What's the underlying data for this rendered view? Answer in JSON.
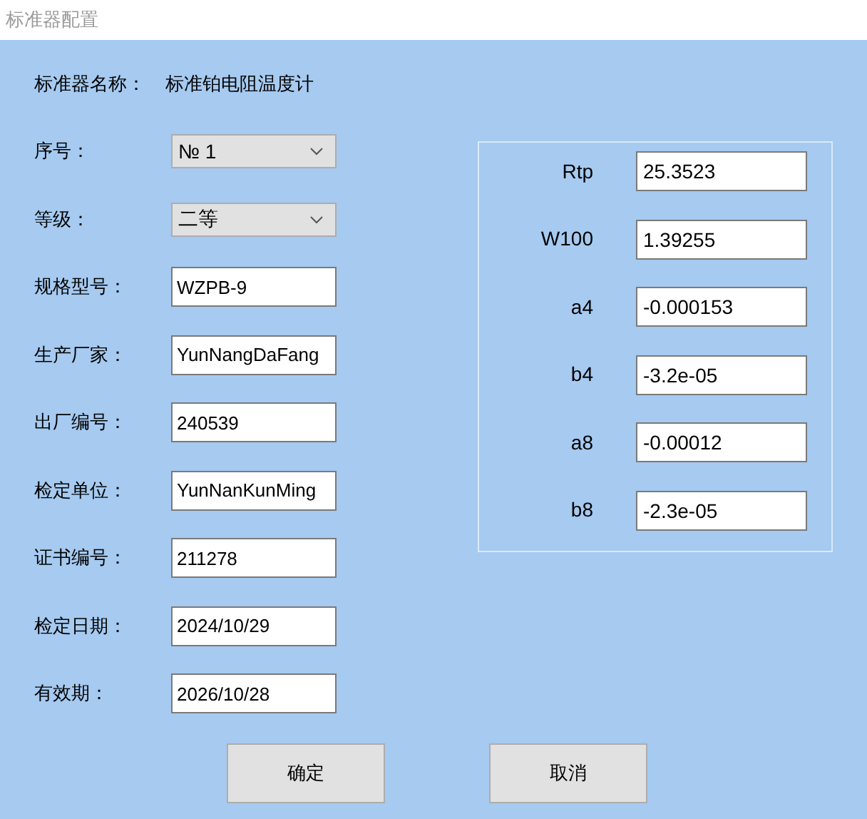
{
  "window": {
    "title": "标准器配置"
  },
  "standard_name": {
    "label": "标准器名称：",
    "value": "标准铂电阻温度计"
  },
  "fields": [
    {
      "label": "序号：",
      "kind": "combo",
      "value": "№ 1"
    },
    {
      "label": "等级：",
      "kind": "combo",
      "value": "二等"
    },
    {
      "label": "规格型号：",
      "kind": "text",
      "value": "WZPB-9"
    },
    {
      "label": "生产厂家：",
      "kind": "text",
      "value": "YunNangDaFang"
    },
    {
      "label": "出厂编号：",
      "kind": "text",
      "value": "240539"
    },
    {
      "label": "检定单位：",
      "kind": "text",
      "value": "YunNanKunMing"
    },
    {
      "label": "证书编号：",
      "kind": "text",
      "value": "211278"
    },
    {
      "label": "检定日期：",
      "kind": "text",
      "value": "2024/10/29"
    },
    {
      "label": "有效期：",
      "kind": "text",
      "value": "2026/10/28"
    }
  ],
  "coefficients": [
    {
      "label": "Rtp",
      "value": "25.3523"
    },
    {
      "label": "W100",
      "value": "1.39255"
    },
    {
      "label": "a4",
      "value": "-0.000153"
    },
    {
      "label": "b4",
      "value": "-3.2e-05"
    },
    {
      "label": "a8",
      "value": "-0.00012"
    },
    {
      "label": "b8",
      "value": "-2.3e-05"
    }
  ],
  "buttons": [
    "确定",
    "取消"
  ]
}
